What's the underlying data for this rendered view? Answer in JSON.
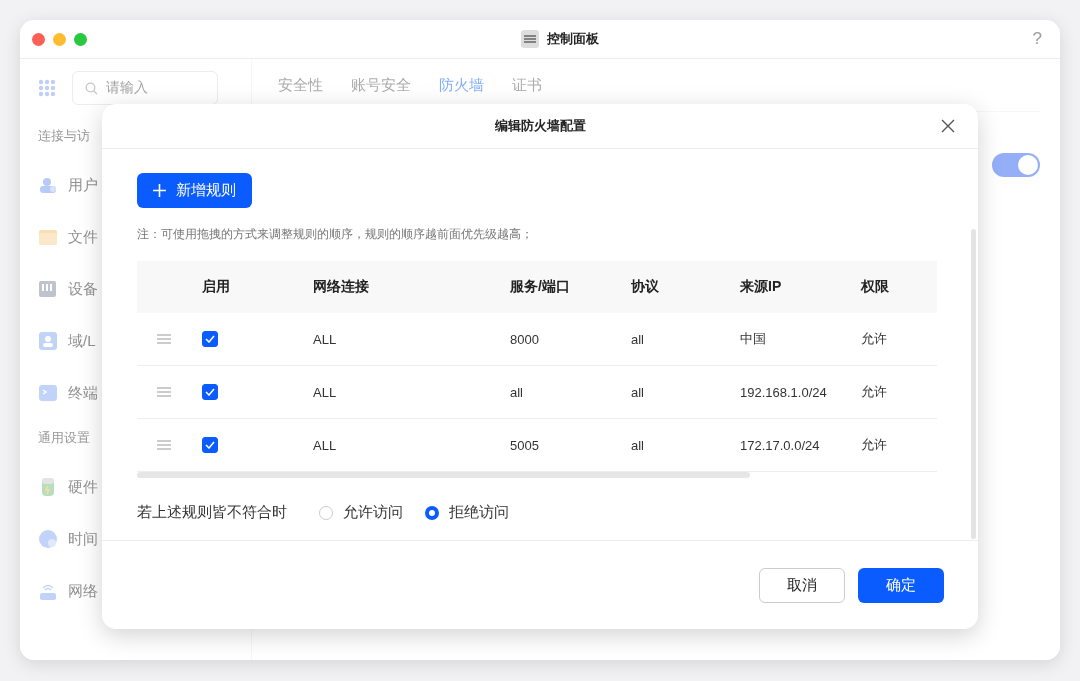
{
  "window": {
    "title": "控制面板",
    "help": "?"
  },
  "sidebar": {
    "search_placeholder": "请输入",
    "sections": [
      {
        "heading": "连接与访",
        "items": [
          {
            "label": "用户",
            "kind": "users"
          },
          {
            "label": "文件",
            "kind": "folder"
          },
          {
            "label": "设备",
            "kind": "device"
          },
          {
            "label": "域/L",
            "kind": "contact"
          },
          {
            "label": "终端",
            "kind": "terminal"
          }
        ]
      },
      {
        "heading": "通用设置",
        "items": [
          {
            "label": "硬件",
            "kind": "battery"
          },
          {
            "label": "时间",
            "kind": "clock"
          },
          {
            "label": "网络",
            "kind": "router"
          }
        ]
      }
    ]
  },
  "tabs": [
    {
      "label": "安全性",
      "selected": false
    },
    {
      "label": "账号安全",
      "selected": false
    },
    {
      "label": "防火墙",
      "selected": true
    },
    {
      "label": "证书",
      "selected": false
    }
  ],
  "firewall_toggle": {
    "on": true
  },
  "dialog": {
    "title": "编辑防火墙配置",
    "add_button": "新增规则",
    "note": "注：可使用拖拽的方式来调整规则的顺序，规则的顺序越前面优先级越高；",
    "table": {
      "columns": [
        "启用",
        "网络连接",
        "服务/端口",
        "协议",
        "来源IP",
        "权限"
      ],
      "rows": [
        {
          "cells": [
            {
              "kind": "checkbox",
              "checked": true
            },
            {
              "kind": "text",
              "text": "ALL"
            },
            {
              "kind": "text",
              "text": "8000"
            },
            {
              "kind": "text",
              "text": "all"
            },
            {
              "kind": "text",
              "text": "中国"
            },
            {
              "kind": "text",
              "text": "允许"
            }
          ]
        },
        {
          "cells": [
            {
              "kind": "checkbox",
              "checked": true
            },
            {
              "kind": "text",
              "text": "ALL"
            },
            {
              "kind": "text",
              "text": "all"
            },
            {
              "kind": "text",
              "text": "all"
            },
            {
              "kind": "text",
              "text": "192.168.1.0/24"
            },
            {
              "kind": "text",
              "text": "允许"
            }
          ]
        },
        {
          "cells": [
            {
              "kind": "checkbox",
              "checked": true
            },
            {
              "kind": "text",
              "text": "ALL"
            },
            {
              "kind": "text",
              "text": "5005"
            },
            {
              "kind": "text",
              "text": "all"
            },
            {
              "kind": "text",
              "text": "172.17.0.0/24"
            },
            {
              "kind": "text",
              "text": "允许"
            }
          ]
        }
      ]
    },
    "default_action": {
      "label": "若上述规则皆不符合时",
      "options": [
        {
          "label": "允许访问",
          "selected": false
        },
        {
          "label": "拒绝访问",
          "selected": true
        }
      ]
    },
    "buttons": [
      {
        "label": "取消",
        "kind": "secondary"
      },
      {
        "label": "确定",
        "kind": "primary"
      }
    ]
  }
}
